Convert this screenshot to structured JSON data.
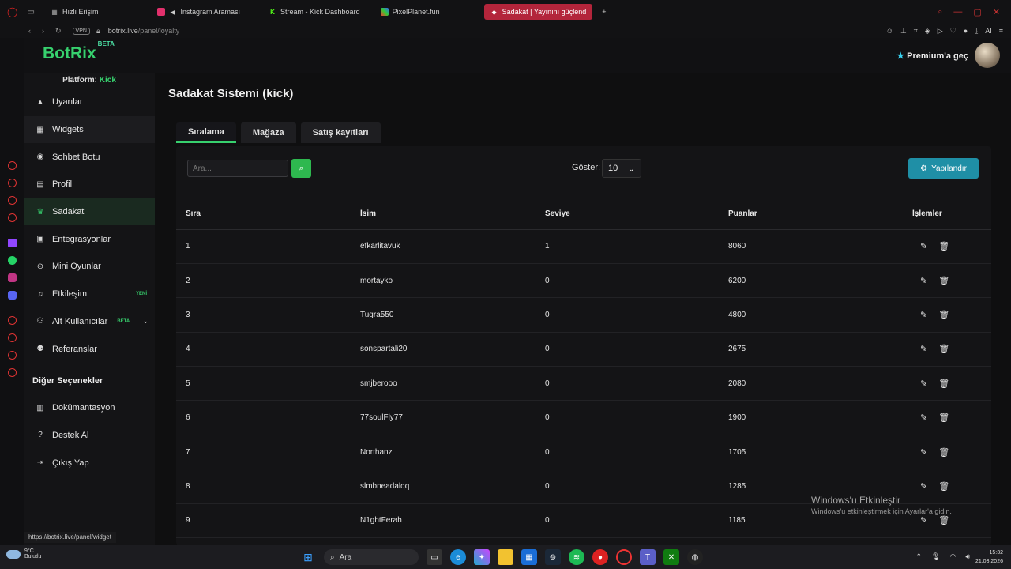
{
  "browser": {
    "tabs": [
      {
        "label": "Hızlı Erişim",
        "color": "#888888",
        "active": false
      },
      {
        "label": "Instagram Araması",
        "color": "#e1306c",
        "active": false
      },
      {
        "label": "Stream - Kick Dashboard",
        "color": "#53fc18",
        "active": false
      },
      {
        "label": "PixelPlanet.fun",
        "color": "#7a5cff",
        "active": false
      },
      {
        "label": "Sadakat | Yayınını güçlend",
        "color": "#ffffff",
        "active": true
      }
    ],
    "new_tab": "+",
    "vpn": "VPN",
    "url_host": "botrix.live",
    "url_path": "/panel/loyalty",
    "ai_label": "AI"
  },
  "app": {
    "logo": "BotRix",
    "logo_badge": "BETA",
    "premium": "Premium'a geç",
    "platform_label": "Platform:",
    "platform_value": "Kick"
  },
  "sidebar": {
    "items": [
      {
        "label": "Uyarılar",
        "icon": "warning-icon"
      },
      {
        "label": "Widgets",
        "icon": "widgets-icon"
      },
      {
        "label": "Sohbet Botu",
        "icon": "robot-icon"
      },
      {
        "label": "Profil",
        "icon": "profile-icon"
      },
      {
        "label": "Sadakat",
        "icon": "trophy-icon"
      },
      {
        "label": "Entegrasyonlar",
        "icon": "integrations-icon"
      },
      {
        "label": "Mini Oyunlar",
        "icon": "gamepad-icon"
      },
      {
        "label": "Etkileşim",
        "icon": "music-icon",
        "badge": "YENİ"
      },
      {
        "label": "Alt Kullanıcılar",
        "icon": "users-icon",
        "badge": "BETA"
      },
      {
        "label": "Referanslar",
        "icon": "referrals-icon"
      }
    ],
    "other_header": "Diğer Seçenekler",
    "other_items": [
      {
        "label": "Dokümantasyon",
        "icon": "docs-icon"
      },
      {
        "label": "Destek Al",
        "icon": "help-icon"
      },
      {
        "label": "Çıkış Yap",
        "icon": "logout-icon"
      }
    ]
  },
  "status_url": "https://botrix.live/panel/widget",
  "main": {
    "title": "Sadakat Sistemi (kick)",
    "tabs": [
      {
        "label": "Sıralama",
        "active": true
      },
      {
        "label": "Mağaza",
        "active": false
      },
      {
        "label": "Satış kayıtları",
        "active": false
      }
    ],
    "search_placeholder": "Ara...",
    "show_label": "Göster:",
    "show_value": "10",
    "configure": "Yapılandır",
    "columns": [
      "Sıra",
      "İsim",
      "Seviye",
      "Puanlar",
      "İşlemler"
    ],
    "rows": [
      {
        "rank": "1",
        "name": "efkarlitavuk",
        "level": "1",
        "points": "8060"
      },
      {
        "rank": "2",
        "name": "mortayko",
        "level": "0",
        "points": "6200"
      },
      {
        "rank": "3",
        "name": "Tugra550",
        "level": "0",
        "points": "4800"
      },
      {
        "rank": "4",
        "name": "sonspartali20",
        "level": "0",
        "points": "2675"
      },
      {
        "rank": "5",
        "name": "smjberooo",
        "level": "0",
        "points": "2080"
      },
      {
        "rank": "6",
        "name": "77soulFly77",
        "level": "0",
        "points": "1900"
      },
      {
        "rank": "7",
        "name": "Northanz",
        "level": "0",
        "points": "1705"
      },
      {
        "rank": "8",
        "name": "slmbneadalqq",
        "level": "0",
        "points": "1285"
      },
      {
        "rank": "9",
        "name": "N1ghtFerah",
        "level": "0",
        "points": "1185"
      }
    ]
  },
  "watermark": {
    "line1": "Windows'u Etkinleştir",
    "line2": "Windows'u etkinleştirmek için Ayarlar'a gidin."
  },
  "taskbar": {
    "temp": "9°C",
    "weather": "Bulutlu",
    "search": "Ara",
    "time": "15:32",
    "date": "21.03.2026"
  },
  "colors": {
    "accent_green": "#37d16e",
    "configure_teal": "#1f8fa6",
    "active_tab_red": "#b3253b"
  }
}
